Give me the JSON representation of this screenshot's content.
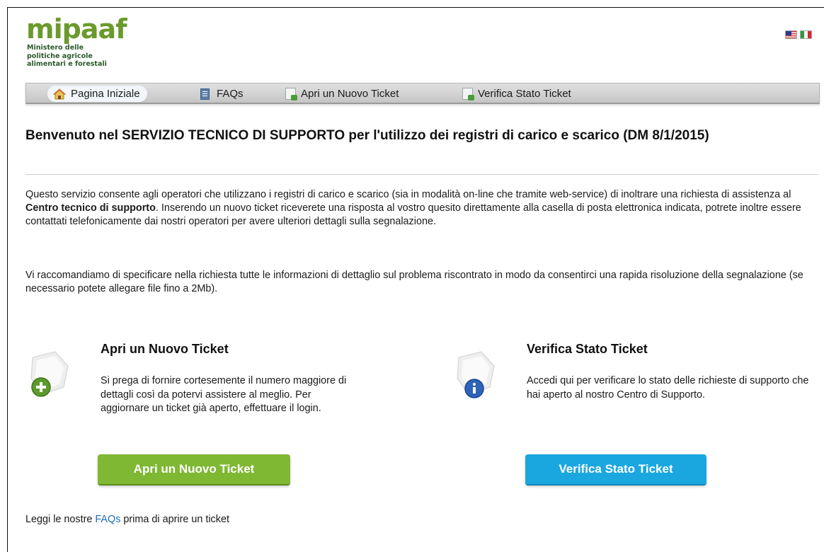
{
  "header": {
    "logo_text": "mipaaf",
    "logo_subtitle_lines": [
      "Ministero delle",
      "politiche agricole",
      "alimentari e forestali"
    ],
    "flags": [
      "us-flag-icon",
      "italy-flag-icon"
    ]
  },
  "nav": {
    "items": [
      {
        "label": "Pagina Iniziale",
        "icon": "home-icon",
        "active": true
      },
      {
        "label": "FAQs",
        "icon": "document-icon"
      },
      {
        "label": "Apri un Nuovo Ticket",
        "icon": "new-ticket-icon"
      },
      {
        "label": "Verifica Stato Ticket",
        "icon": "check-ticket-icon"
      }
    ]
  },
  "main": {
    "title": "Benvenuto nel SERVIZIO TECNICO DI SUPPORTO per l'utilizzo dei registri di carico e scarico (DM 8/1/2015)",
    "para1_part1": "Questo servizio consente agli operatori che utilizzano i registri di carico e scarico (sia in modalità on-line che tramite web-service) di inoltrare una richiesta di assistenza al ",
    "para1_bold": "Centro tecnico di supporto",
    "para1_part2": ". Inserendo un nuovo ticket riceverete una risposta al vostro quesito direttamente alla casella di posta elettronica indicata, potrete inoltre essere contattati telefonicamente dai nostri operatori per avere ulteriori dettagli sulla segnalazione.",
    "para2": "Vi raccomandiamo di specificare nella richiesta tutte le informazioni di dettaglio sul problema riscontrato in modo da consentirci una rapida risoluzione della segnalazione (se necessario potete allegare file fino a 2Mb)."
  },
  "cards": {
    "new_ticket": {
      "title": "Apri un Nuovo Ticket",
      "text": "Si prega di fornire cortesemente il numero maggiore di dettagli così da potervi assistere al meglio. Per aggiornare un ticket già aperto, effettuare il login.",
      "button": "Apri un Nuovo Ticket",
      "color": "#7fb832"
    },
    "check_ticket": {
      "title": "Verifica Stato Ticket",
      "text": "Accedi qui per verificare lo stato delle richieste di supporto che hai aperto al nostro Centro di Supporto.",
      "button": "Verifica Stato Ticket",
      "color": "#1aa7e0"
    }
  },
  "footer": {
    "before": "Leggi le nostre ",
    "link": "FAQs",
    "after": " prima di aprire un ticket"
  }
}
